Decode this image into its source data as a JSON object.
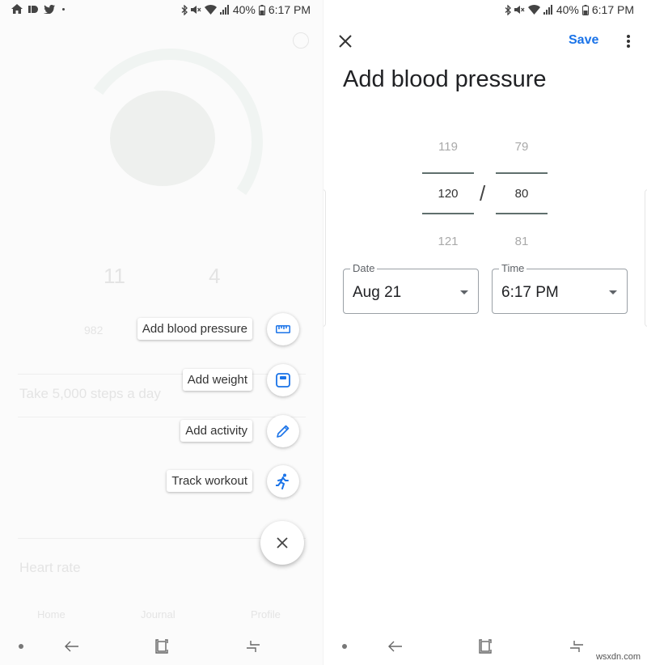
{
  "status_bar": {
    "battery": "40%",
    "time": "6:17 PM"
  },
  "speed_dial": {
    "items": [
      {
        "label": "Add blood pressure",
        "icon": "ruler-icon"
      },
      {
        "label": "Add weight",
        "icon": "scale-icon"
      },
      {
        "label": "Add activity",
        "icon": "pencil-icon"
      },
      {
        "label": "Track workout",
        "icon": "running-person-icon"
      }
    ],
    "close_icon": "close-icon"
  },
  "background_screen": {
    "goal_text": "Take 5,000 steps a day",
    "heart_rate_title": "Heart rate",
    "metric_1_value": "11",
    "metric_2_value": "4",
    "steps_value": "982",
    "nav_tabs": [
      "Home",
      "Journal",
      "Profile"
    ]
  },
  "form": {
    "save_label": "Save",
    "title": "Add blood pressure",
    "systolic": {
      "above": "119",
      "selected": "120",
      "below": "121"
    },
    "diastolic": {
      "above": "79",
      "selected": "80",
      "below": "81"
    },
    "separator": "/",
    "date": {
      "label": "Date",
      "value": "Aug 21"
    },
    "time": {
      "label": "Time",
      "value": "6:17 PM"
    }
  },
  "colors": {
    "accent": "#1a73e8",
    "icon_blue": "#1a73e8"
  },
  "watermark": "wsxdn.com"
}
